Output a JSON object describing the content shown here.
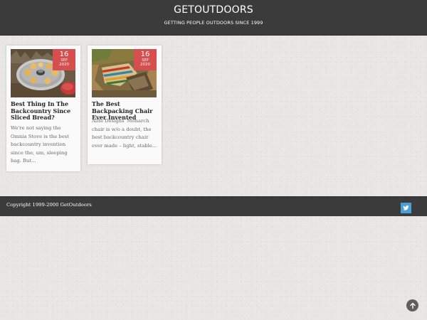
{
  "header": {
    "title": "GETOUTDOORS",
    "tagline": "GETTING PEOPLE OUTDOORS SINCE 1999"
  },
  "posts": [
    {
      "title": "Best Thing In The Backcountry Since Sliced Bread?",
      "excerpt": "We're not saying the Omnia Stove is the best backcountry invention since the, um, sleeping bag. But...",
      "date": {
        "day": "16",
        "month": "SEP",
        "year": "2020"
      }
    },
    {
      "title": "The Best Backpacking Chair Ever Invented",
      "excerpt": "Alite Designs' Monarch chair is w/o a doubt, the best backcountry chair ever made – light, stable...",
      "date": {
        "day": "16",
        "month": "SEP",
        "year": "2020"
      }
    }
  ],
  "footer": {
    "copyright": "Copyright 1999-2000 GetOutdoors"
  },
  "icons": {
    "social": "twitter-icon",
    "scroll": "arrow-up-icon"
  },
  "colors": {
    "header_bg": "#3b3b3b",
    "date_badge": "#d64e4e",
    "twitter": "#4a9fd8"
  }
}
